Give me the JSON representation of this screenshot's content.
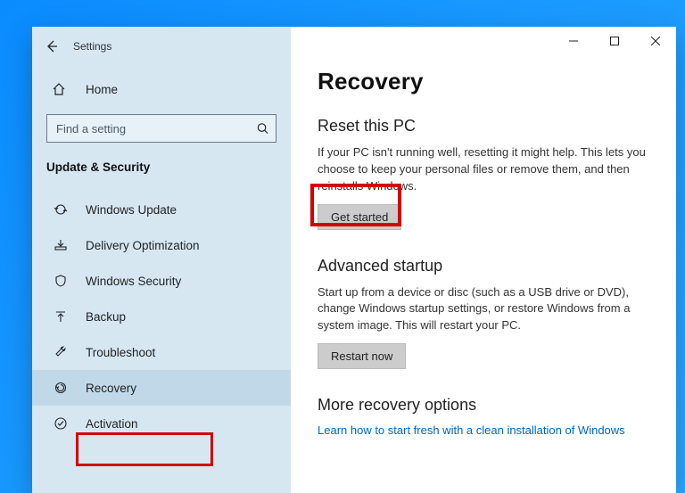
{
  "app": {
    "title": "Settings"
  },
  "home_label": "Home",
  "search": {
    "placeholder": "Find a setting"
  },
  "category_title": "Update & Security",
  "sidebar": {
    "items": [
      {
        "label": "Windows Update"
      },
      {
        "label": "Delivery Optimization"
      },
      {
        "label": "Windows Security"
      },
      {
        "label": "Backup"
      },
      {
        "label": "Troubleshoot"
      },
      {
        "label": "Recovery"
      },
      {
        "label": "Activation"
      }
    ]
  },
  "page": {
    "title": "Recovery",
    "reset": {
      "heading": "Reset this PC",
      "desc": "If your PC isn't running well, resetting it might help. This lets you choose to keep your personal files or remove them, and then reinstalls Windows.",
      "button": "Get started"
    },
    "advanced": {
      "heading": "Advanced startup",
      "desc": "Start up from a device or disc (such as a USB drive or DVD), change Windows startup settings, or restore Windows from a system image. This will restart your PC.",
      "button": "Restart now"
    },
    "more": {
      "heading": "More recovery options",
      "link": "Learn how to start fresh with a clean installation of Windows"
    }
  }
}
